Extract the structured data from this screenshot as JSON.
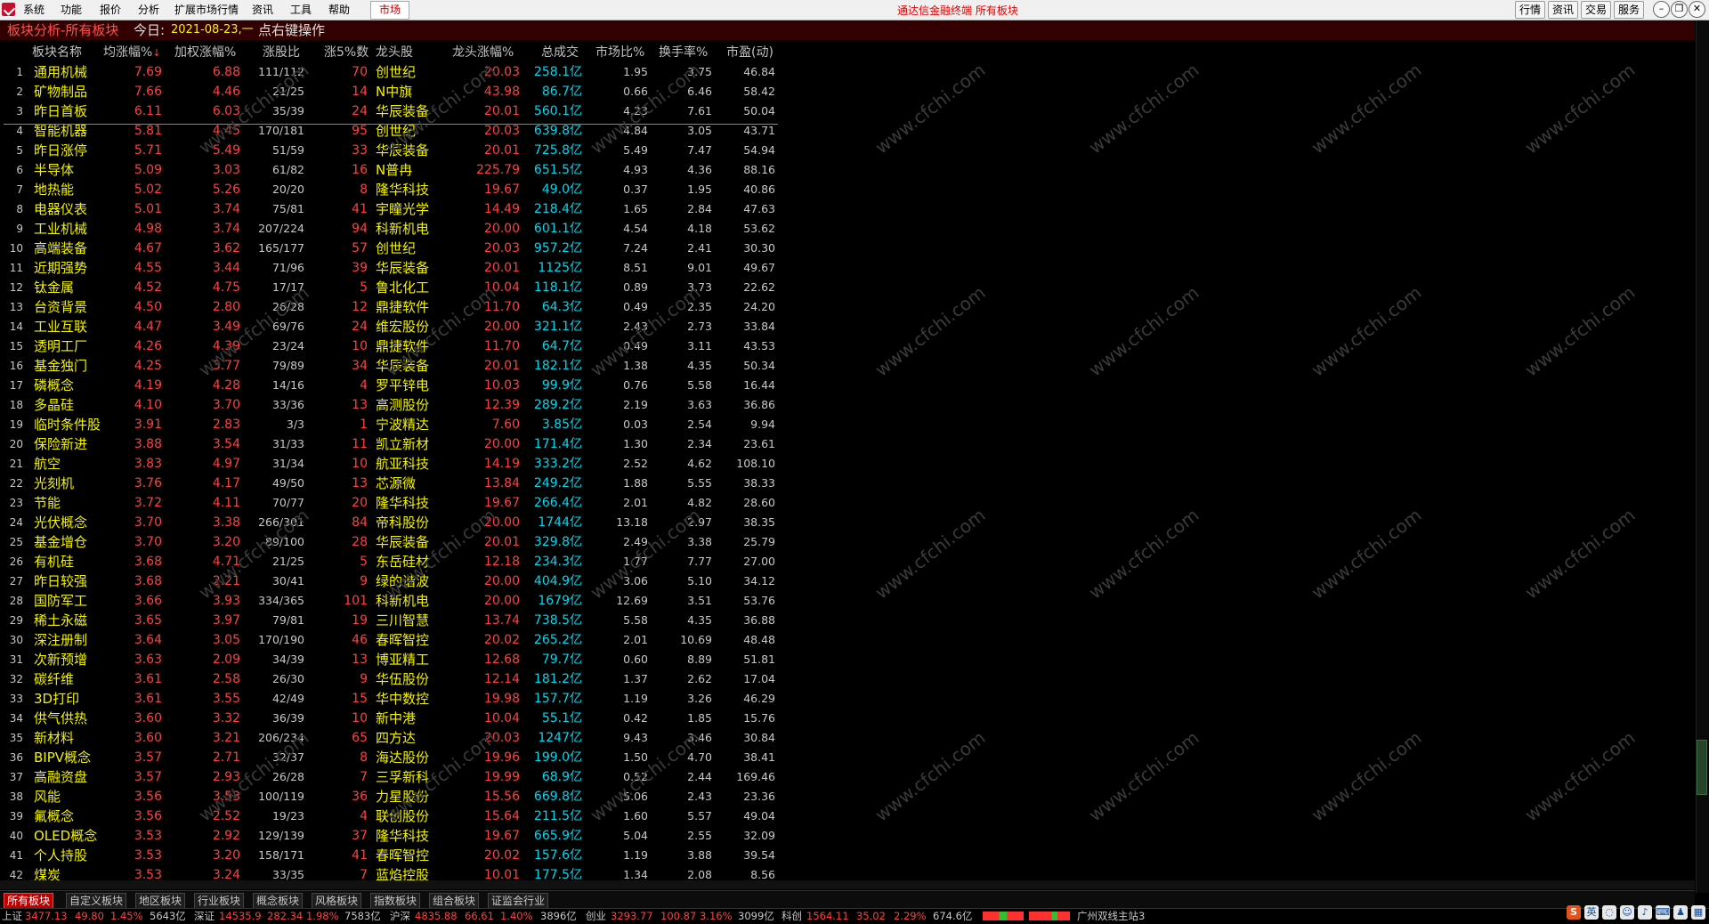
{
  "menu": {
    "items": [
      "系统",
      "功能",
      "报价",
      "分析",
      "扩展市场行情",
      "资讯",
      "工具",
      "帮助"
    ],
    "active_tab": "市场",
    "window_title": "通达信金融终端  所有板块",
    "right_buttons": [
      "行情",
      "资讯",
      "交易",
      "服务"
    ]
  },
  "title_line": {
    "section": "板块分析-所有板块",
    "today_label": "今日:",
    "today_value": "2021-08-23,一",
    "hint": "点右键操作"
  },
  "table": {
    "headers": [
      "板块名称",
      "均涨幅%",
      "加权涨幅%",
      "涨股比",
      "涨5%数",
      "龙头股",
      "龙头涨幅%",
      "总成交",
      "市场比%",
      "换手率%",
      "市盈(动)"
    ],
    "rows": [
      [
        "1",
        "通用机械",
        "7.69",
        "6.88",
        "111/112",
        "70",
        "创世纪",
        "20.03",
        "258.1亿",
        "1.95",
        "3.75",
        "46.84"
      ],
      [
        "2",
        "矿物制品",
        "7.66",
        "4.46",
        "21/25",
        "14",
        "N中旗",
        "43.98",
        "86.7亿",
        "0.66",
        "6.46",
        "58.42"
      ],
      [
        "3",
        "昨日首板",
        "6.11",
        "6.03",
        "35/39",
        "24",
        "华辰装备",
        "20.01",
        "560.1亿",
        "4.23",
        "7.61",
        "50.04"
      ],
      [
        "4",
        "智能机器",
        "5.81",
        "4.45",
        "170/181",
        "95",
        "创世纪",
        "20.03",
        "639.8亿",
        "4.84",
        "3.05",
        "43.71"
      ],
      [
        "5",
        "昨日涨停",
        "5.71",
        "5.49",
        "51/59",
        "33",
        "华辰装备",
        "20.01",
        "725.8亿",
        "5.49",
        "7.47",
        "54.94"
      ],
      [
        "6",
        "半导体",
        "5.09",
        "3.03",
        "61/82",
        "16",
        "N普冉",
        "225.79",
        "651.5亿",
        "4.93",
        "4.36",
        "88.16"
      ],
      [
        "7",
        "地热能",
        "5.02",
        "5.26",
        "20/20",
        "8",
        "隆华科技",
        "19.67",
        "49.0亿",
        "0.37",
        "1.95",
        "40.86"
      ],
      [
        "8",
        "电器仪表",
        "5.01",
        "3.74",
        "75/81",
        "41",
        "宇瞳光学",
        "14.49",
        "218.4亿",
        "1.65",
        "2.84",
        "47.63"
      ],
      [
        "9",
        "工业机械",
        "4.98",
        "3.74",
        "207/224",
        "94",
        "科新机电",
        "20.00",
        "601.1亿",
        "4.54",
        "4.18",
        "53.62"
      ],
      [
        "10",
        "高端装备",
        "4.67",
        "3.62",
        "165/177",
        "57",
        "创世纪",
        "20.03",
        "957.2亿",
        "7.24",
        "2.41",
        "30.30"
      ],
      [
        "11",
        "近期强势",
        "4.55",
        "3.44",
        "71/96",
        "39",
        "华辰装备",
        "20.01",
        "1125亿",
        "8.51",
        "9.01",
        "49.67"
      ],
      [
        "12",
        "钛金属",
        "4.52",
        "4.75",
        "17/17",
        "5",
        "鲁北化工",
        "10.04",
        "118.1亿",
        "0.89",
        "3.73",
        "22.62"
      ],
      [
        "13",
        "台资背景",
        "4.50",
        "2.80",
        "26/28",
        "12",
        "鼎捷软件",
        "11.70",
        "64.3亿",
        "0.49",
        "2.35",
        "24.20"
      ],
      [
        "14",
        "工业互联",
        "4.47",
        "3.49",
        "69/76",
        "24",
        "维宏股份",
        "20.00",
        "321.1亿",
        "2.43",
        "2.73",
        "33.84"
      ],
      [
        "15",
        "透明工厂",
        "4.26",
        "4.39",
        "23/24",
        "10",
        "鼎捷软件",
        "11.70",
        "64.7亿",
        "0.49",
        "3.11",
        "43.53"
      ],
      [
        "16",
        "基金独门",
        "4.25",
        "3.77",
        "79/89",
        "34",
        "华辰装备",
        "20.01",
        "182.1亿",
        "1.38",
        "4.35",
        "50.34"
      ],
      [
        "17",
        "磷概念",
        "4.19",
        "4.28",
        "14/16",
        "4",
        "罗平锌电",
        "10.03",
        "99.9亿",
        "0.76",
        "5.58",
        "16.44"
      ],
      [
        "18",
        "多晶硅",
        "4.10",
        "3.70",
        "33/36",
        "13",
        "高测股份",
        "12.39",
        "289.2亿",
        "2.19",
        "3.63",
        "36.86"
      ],
      [
        "19",
        "临时条件股",
        "3.91",
        "2.83",
        "3/3",
        "1",
        "宁波精达",
        "7.60",
        "3.85亿",
        "0.03",
        "2.54",
        "9.94"
      ],
      [
        "20",
        "保险新进",
        "3.88",
        "3.54",
        "31/33",
        "11",
        "凯立新材",
        "20.00",
        "171.4亿",
        "1.30",
        "2.34",
        "23.61"
      ],
      [
        "21",
        "航空",
        "3.83",
        "4.97",
        "31/34",
        "10",
        "航亚科技",
        "14.19",
        "333.2亿",
        "2.52",
        "4.62",
        "108.10"
      ],
      [
        "22",
        "光刻机",
        "3.76",
        "4.17",
        "49/50",
        "13",
        "芯源微",
        "13.84",
        "249.2亿",
        "1.88",
        "5.55",
        "38.33"
      ],
      [
        "23",
        "节能",
        "3.72",
        "4.11",
        "70/77",
        "20",
        "隆华科技",
        "19.67",
        "266.4亿",
        "2.01",
        "4.82",
        "28.60"
      ],
      [
        "24",
        "光伏概念",
        "3.70",
        "3.38",
        "266/301",
        "84",
        "帝科股份",
        "20.00",
        "1744亿",
        "13.18",
        "2.97",
        "38.35"
      ],
      [
        "25",
        "基金增仓",
        "3.70",
        "3.20",
        "89/100",
        "28",
        "华辰装备",
        "20.01",
        "329.8亿",
        "2.49",
        "3.38",
        "25.79"
      ],
      [
        "26",
        "有机硅",
        "3.68",
        "4.71",
        "21/25",
        "5",
        "东岳硅材",
        "12.18",
        "234.3亿",
        "1.77",
        "7.77",
        "27.00"
      ],
      [
        "27",
        "昨日较强",
        "3.68",
        "2.21",
        "30/41",
        "9",
        "绿的谐波",
        "20.00",
        "404.9亿",
        "3.06",
        "5.10",
        "34.12"
      ],
      [
        "28",
        "国防军工",
        "3.66",
        "3.93",
        "334/365",
        "101",
        "科新机电",
        "20.00",
        "1679亿",
        "12.69",
        "3.51",
        "53.76"
      ],
      [
        "29",
        "稀土永磁",
        "3.65",
        "3.97",
        "79/81",
        "19",
        "三川智慧",
        "13.74",
        "738.5亿",
        "5.58",
        "4.35",
        "36.88"
      ],
      [
        "30",
        "深注册制",
        "3.64",
        "3.05",
        "170/190",
        "46",
        "春晖智控",
        "20.02",
        "265.2亿",
        "2.01",
        "10.69",
        "48.48"
      ],
      [
        "31",
        "次新预增",
        "3.63",
        "2.09",
        "34/39",
        "13",
        "博亚精工",
        "12.68",
        "79.7亿",
        "0.60",
        "8.89",
        "51.81"
      ],
      [
        "32",
        "碳纤维",
        "3.61",
        "2.58",
        "26/30",
        "9",
        "华伍股份",
        "12.14",
        "181.2亿",
        "1.37",
        "2.62",
        "17.04"
      ],
      [
        "33",
        "3D打印",
        "3.61",
        "3.55",
        "42/49",
        "15",
        "华中数控",
        "19.98",
        "157.7亿",
        "1.19",
        "3.26",
        "46.29"
      ],
      [
        "34",
        "供气供热",
        "3.60",
        "3.32",
        "36/39",
        "10",
        "新中港",
        "10.04",
        "55.1亿",
        "0.42",
        "1.85",
        "15.76"
      ],
      [
        "35",
        "新材料",
        "3.60",
        "3.21",
        "206/234",
        "65",
        "四方达",
        "20.03",
        "1247亿",
        "9.43",
        "3.46",
        "30.84"
      ],
      [
        "36",
        "BIPV概念",
        "3.57",
        "2.71",
        "32/37",
        "8",
        "海达股份",
        "19.96",
        "199.0亿",
        "1.50",
        "4.70",
        "38.41"
      ],
      [
        "37",
        "高融资盘",
        "3.57",
        "2.93",
        "26/28",
        "7",
        "三孚新科",
        "19.99",
        "68.9亿",
        "0.52",
        "2.44",
        "169.46"
      ],
      [
        "38",
        "风能",
        "3.56",
        "3.53",
        "100/119",
        "36",
        "力星股份",
        "15.56",
        "669.8亿",
        "5.06",
        "2.43",
        "23.36"
      ],
      [
        "39",
        "氟概念",
        "3.56",
        "2.52",
        "19/23",
        "4",
        "联创股份",
        "15.64",
        "211.5亿",
        "1.60",
        "5.57",
        "49.04"
      ],
      [
        "40",
        "OLED概念",
        "3.53",
        "2.92",
        "129/139",
        "37",
        "隆华科技",
        "19.67",
        "665.9亿",
        "5.04",
        "2.55",
        "32.09"
      ],
      [
        "41",
        "个人持股",
        "3.53",
        "3.20",
        "158/171",
        "41",
        "春晖智控",
        "20.02",
        "157.6亿",
        "1.19",
        "3.88",
        "39.54"
      ],
      [
        "42",
        "煤炭",
        "3.53",
        "3.24",
        "33/35",
        "7",
        "蓝焰控股",
        "10.01",
        "177.5亿",
        "1.34",
        "2.08",
        "8.56"
      ]
    ]
  },
  "watermark": "www.cfchi.com",
  "tabs": [
    "所有板块",
    "自定义板块",
    "地区板块",
    "行业板块",
    "概念板块",
    "风格板块",
    "指数板块",
    "组合板块",
    "证监会行业"
  ],
  "status": [
    {
      "name": "上证",
      "price": "3477.13",
      "chg": "49.80",
      "pct": "1.45%",
      "vol": "5643亿"
    },
    {
      "name": "深证",
      "price": "14535.9",
      "chg": "282.34",
      "pct": "1.98%",
      "vol": "7583亿"
    },
    {
      "name": "沪深",
      "price": "4835.88",
      "chg": "66.61",
      "pct": "1.40%",
      "vol": "3896亿"
    },
    {
      "name": "创业",
      "price": "3293.77",
      "chg": "100.87",
      "pct": "3.16%",
      "vol": "3099亿"
    },
    {
      "name": "科创",
      "price": "1564.11",
      "chg": "35.02",
      "pct": "2.29%",
      "vol": "674.6亿"
    }
  ],
  "server": "广州双线主站3",
  "tray": {
    "sogou": "S",
    "lang": "英"
  },
  "colors": {
    "up": "#ff4040",
    "name": "#f2f200",
    "volume": "#00d8f0",
    "title_bg": "#330000"
  }
}
